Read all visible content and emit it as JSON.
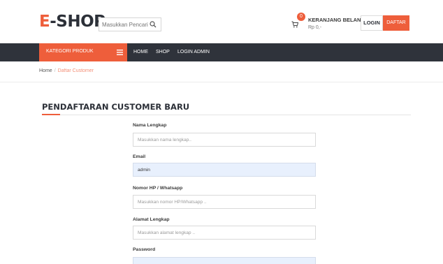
{
  "header": {
    "logo_e": "E",
    "logo_rest": "-SHOP",
    "search_placeholder": "Masukkan Pencarian...",
    "cart_count": "0",
    "cart_title": "KERANJANG BELANJA :",
    "cart_total": "Rp 0,-",
    "login_label": "LOGIN",
    "daftar_label": "DAFTAR"
  },
  "navbar": {
    "category_label": "KATEGORI PRODUK",
    "items": [
      "HOME",
      "SHOP",
      "LOGIN ADMIN"
    ]
  },
  "breadcrumb": {
    "home": "Home",
    "separator": "/",
    "current": "Daftar Customer"
  },
  "form": {
    "title": "PENDAFTARAN CUSTOMER BARU",
    "fields": [
      {
        "label": "Nama Lengkap",
        "placeholder": "Masukkan nama lengkap..",
        "value": ""
      },
      {
        "label": "Email",
        "placeholder": "",
        "value": "admin"
      },
      {
        "label": "Nomor HP / Whatsapp",
        "placeholder": "Masukkan nomor HP/Whatsapp ..",
        "value": ""
      },
      {
        "label": "Alamat Lengkap",
        "placeholder": "Masukkan alamat lengkap ..",
        "value": ""
      },
      {
        "label": "Password",
        "placeholder": "",
        "value": ""
      }
    ]
  },
  "colors": {
    "accent": "#ee5e3b",
    "navbar": "#2f333b",
    "autofill": "#e8f0fd"
  },
  "icons": [
    "search-icon",
    "cart-icon",
    "menu-icon"
  ]
}
